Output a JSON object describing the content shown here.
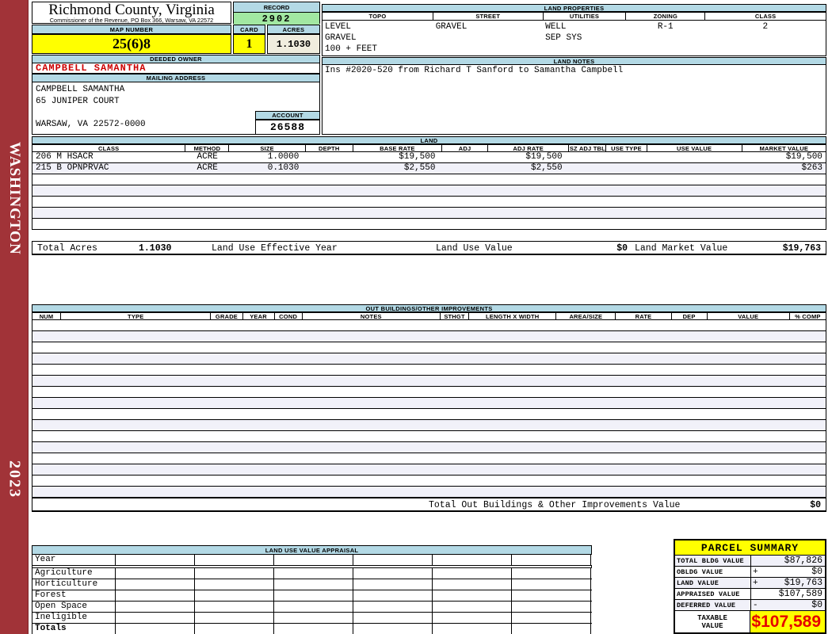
{
  "sidebar": {
    "district": "WASHINGTON",
    "year": "2023"
  },
  "header": {
    "county_title": "Richmond County, Virginia",
    "commissioner_line": "Commissioner of the Revenue, PO Box 366, Warsaw, VA 22572",
    "record_label": "RECORD",
    "record_value": "2902",
    "map_number_label": "MAP NUMBER",
    "map_number_value": "25(6)8",
    "card_label": "CARD",
    "card_value": "1",
    "acres_label": "ACRES",
    "acres_value": "1.1030"
  },
  "owner": {
    "deeded_owner_label": "DEEDED OWNER",
    "name": "CAMPBELL SAMANTHA",
    "mailing_address_label": "MAILING ADDRESS",
    "address_lines": [
      "CAMPBELL SAMANTHA",
      "65 JUNIPER COURT",
      "",
      "WARSAW, VA 22572-0000"
    ],
    "account_label": "ACCOUNT",
    "account_value": "26588"
  },
  "land_properties": {
    "title": "LAND PROPERTIES",
    "columns": [
      "TOPO",
      "STREET",
      "UTILITIES",
      "ZONING",
      "CLASS"
    ],
    "topo": "LEVEL\nGRAVEL\n100 + FEET",
    "street": "GRAVEL",
    "utilities": "WELL\nSEP SYS",
    "zoning": "R-1",
    "class": "2"
  },
  "land_notes": {
    "title": "LAND NOTES",
    "text": "Ins #2020-520 from Richard T Sanford to Samantha Campbell"
  },
  "land": {
    "title": "LAND",
    "columns": [
      "CLASS",
      "METHOD",
      "SIZE",
      "DEPTH",
      "BASE RATE",
      "ADJ",
      "ADJ RATE",
      "SZ ADJ TBL",
      "USE TYPE",
      "USE VALUE",
      "MARKET VALUE"
    ],
    "rows": [
      {
        "class": "206 M HSACR",
        "method": "ACRE",
        "size": "1.0000",
        "depth": "",
        "base_rate": "$19,500",
        "adj": "",
        "adj_rate": "$19,500",
        "sz_adj_tbl": "",
        "use_type": "",
        "use_value": "",
        "market_value": "$19,500"
      },
      {
        "class": "215 B OPNPRVAC",
        "method": "ACRE",
        "size": "0.1030",
        "depth": "",
        "base_rate": "$2,550",
        "adj": "",
        "adj_rate": "$2,550",
        "sz_adj_tbl": "",
        "use_type": "",
        "use_value": "",
        "market_value": "$263"
      }
    ],
    "totals": {
      "total_acres_label": "Total Acres",
      "total_acres": "1.1030",
      "effective_year_label": "Land Use Effective Year",
      "effective_year": "",
      "use_value_label": "Land Use Value",
      "use_value": "$0",
      "market_value_label": "Land Market Value",
      "market_value": "$19,763"
    }
  },
  "out_buildings": {
    "title": "OUT BUILDINGS/OTHER IMPROVEMENTS",
    "columns": [
      "NUM",
      "TYPE",
      "GRADE",
      "YEAR",
      "COND",
      "NOTES",
      "STHGT",
      "LENGTH X WIDTH",
      "AREA/SIZE",
      "RATE",
      "DEP",
      "VALUE",
      "% COMP"
    ],
    "total_label": "Total Out Buildings & Other Improvements Value",
    "total_value": "$0"
  },
  "land_use_appraisal": {
    "title": "LAND USE VALUE APPRAISAL",
    "row_labels": [
      "Year",
      "Agriculture",
      "Horticulture",
      "Forest",
      "Open Space",
      "Ineligible",
      "Totals"
    ]
  },
  "parcel_summary": {
    "title": "PARCEL SUMMARY",
    "rows": [
      {
        "label": "TOTAL BLDG VALUE",
        "sign": "",
        "value": "$87,826"
      },
      {
        "label": "OBLDG VALUE",
        "sign": "+",
        "value": "$0"
      },
      {
        "label": "LAND VALUE",
        "sign": "+",
        "value": "$19,763"
      },
      {
        "label": "APPRAISED VALUE",
        "sign": "",
        "value": "$107,589"
      },
      {
        "label": "DEFERRED VALUE",
        "sign": "-",
        "value": "$0"
      }
    ],
    "taxable_label": "TAXABLE\nVALUE",
    "taxable_value": "$107,589"
  },
  "colors": {
    "sidebar_red": "#A13338",
    "header_blue": "#B3D9E5",
    "record_green": "#A2E8A2",
    "highlight_yellow": "#FFFF00",
    "acres_cream": "#F0EDDE",
    "owner_red": "#CC0000",
    "taxable_red": "#E60000",
    "row_stripe": "#F1F1F9"
  }
}
